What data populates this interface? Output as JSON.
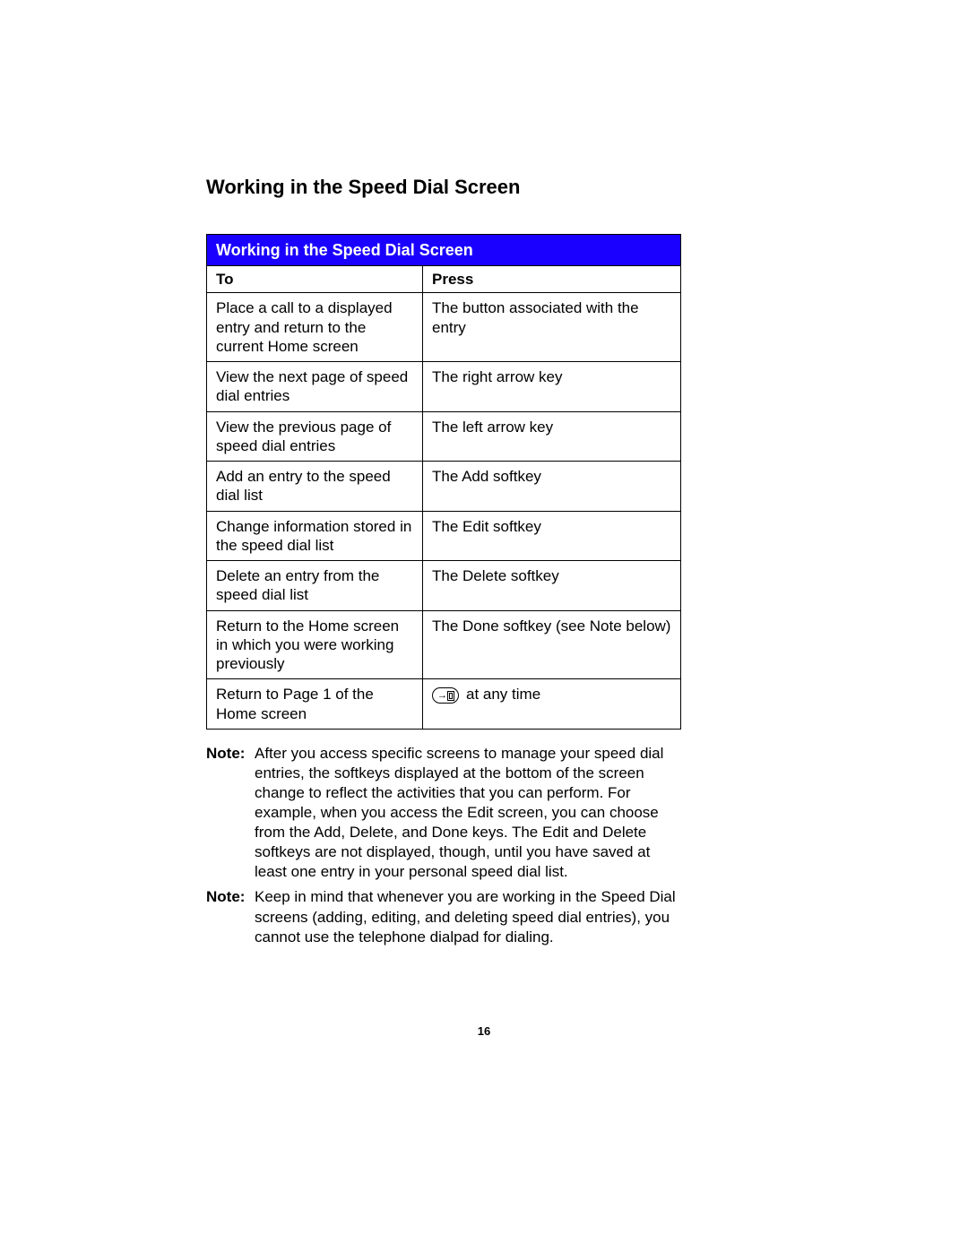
{
  "page": {
    "heading": "Working in the Speed Dial Screen",
    "table_title": "Working in the Speed Dial Screen",
    "columns": {
      "to": "To",
      "press": "Press"
    },
    "rows": [
      {
        "to": "Place a call to a displayed entry and return to the current Home screen",
        "press": "The button associated with the entry",
        "icon": false
      },
      {
        "to": "View the next page of speed dial entries",
        "press": "The right arrow key",
        "icon": false
      },
      {
        "to": "View the previous page of speed dial entries",
        "press": "The left arrow key",
        "icon": false
      },
      {
        "to": "Add an entry to the speed dial list",
        "press": "The Add softkey",
        "icon": false
      },
      {
        "to": "Change information stored in the speed dial list",
        "press": "The Edit softkey",
        "icon": false
      },
      {
        "to": "Delete an entry from the speed dial list",
        "press": "The Delete softkey",
        "icon": false
      },
      {
        "to": "Return to the Home screen in which you were working previously",
        "press": "The Done softkey (see Note below)",
        "icon": false
      },
      {
        "to": "Return to Page 1 of the Home screen",
        "press": "at any time",
        "icon": true
      }
    ],
    "notes": [
      {
        "label": "Note:",
        "body": "After you access specific screens to manage your speed dial entries, the softkeys displayed at the bottom of the screen change to reflect the activities that you can perform. For example, when you access the Edit screen, you can choose from the Add, Delete, and Done keys. The Edit and Delete softkeys are not displayed, though, until you have saved at least one entry in your personal speed dial list."
      },
      {
        "label": "Note:",
        "body": "Keep in mind that whenever you are working in the Speed Dial screens (adding, editing, and deleting speed dial entries), you cannot use the telephone dialpad for dialing."
      }
    ],
    "page_number": "16"
  }
}
